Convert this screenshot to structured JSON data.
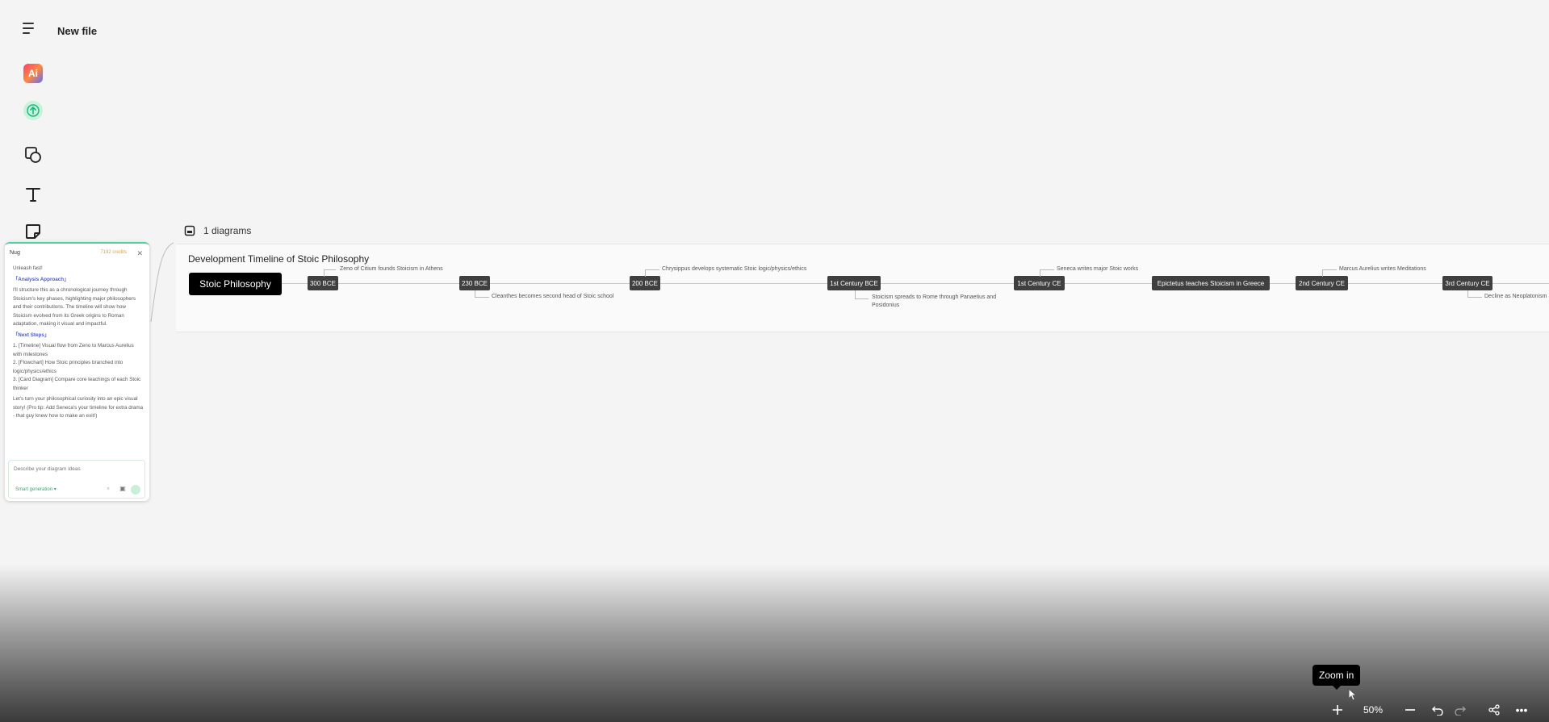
{
  "app": {
    "file_title": "New file"
  },
  "toolbar": {
    "items": [
      "ai-tool",
      "upload",
      "shapes",
      "text",
      "sticky-note"
    ],
    "ai_label": "Ai"
  },
  "canvas": {
    "diagram_count_label": "1 diagrams"
  },
  "diagram": {
    "title": "Development Timeline of Stoic Philosophy",
    "root": "Stoic Philosophy",
    "nodes": [
      "300 BCE",
      "230 BCE",
      "200 BCE",
      "1st Century BCE",
      "1st Century CE",
      "Epictetus teaches Stoicism in Greece",
      "2nd Century CE",
      "3rd Century CE"
    ],
    "events": [
      "Zeno of Citium founds Stoicism in Athens",
      "Cleanthes becomes second head of Stoic school",
      "Chrysippus develops systematic Stoic logic/physics/ethics",
      "Stoicism spreads to Rome through Panaetius and Posidonius",
      "Seneca writes major Stoic works",
      "Marcus Aurelius writes Meditations",
      "Decline as Neoplatonism"
    ]
  },
  "chat": {
    "header": "Nug",
    "credits": "7192 credits",
    "greeting": "Unleash fast!",
    "analysis_heading": "「Analysis Approach」",
    "analysis_text": "I'll structure this as a chronological journey through Stoicism's key phases, highlighting major philosophers and their contributions. The timeline will show how Stoicism evolved from its Greek origins to Roman adaptation, making it visual and impactful.",
    "next_heading": "「Next Steps」",
    "steps": [
      "1. [Timeline] Visual flow from Zeno to Marcus Aurelius with milestones",
      "2. [Flowchart] How Stoic principles branched into logic/physics/ethics",
      "3. [Card Diagram] Compare core teachings of each Stoic thinker"
    ],
    "closing": "Let's turn your philosophical curiosity into an epic visual story! (Pro tip: Add Seneca's your timeline for extra drama - that guy knew how to make an exit!)",
    "input_placeholder": "Describe your diagram ideas",
    "mode_label": "Smart generation"
  },
  "bottom_bar": {
    "zoom_level": "50%",
    "tooltip": "Zoom in"
  }
}
